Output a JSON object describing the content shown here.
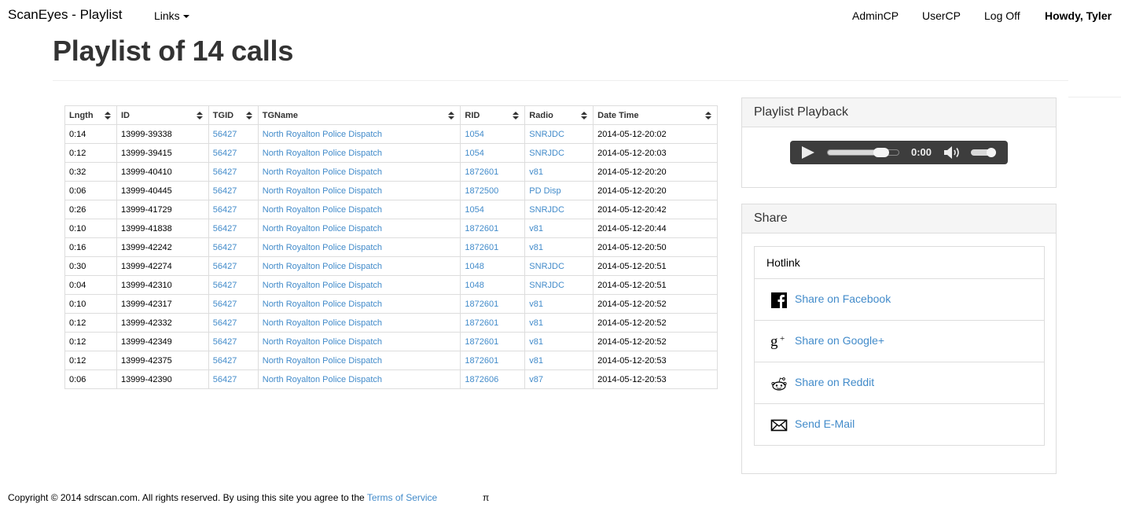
{
  "navbar": {
    "brand": "ScanEyes - Playlist",
    "links_label": "Links",
    "right_items": [
      {
        "label": "AdminCP"
      },
      {
        "label": "UserCP"
      },
      {
        "label": "Log Off"
      }
    ],
    "greeting": "Howdy, Tyler"
  },
  "page": {
    "title": "Playlist of 14 calls"
  },
  "table": {
    "headers": [
      "Lngth",
      "ID",
      "TGID",
      "TGName",
      "RID",
      "Radio",
      "Date Time"
    ],
    "rows": [
      {
        "length": "0:14",
        "id": "13999-39338",
        "tgid": "56427",
        "tgname": "North Royalton Police Dispatch",
        "rid": "1054",
        "radio": "SNRJDC",
        "datetime": "2014-05-12-20:02"
      },
      {
        "length": "0:12",
        "id": "13999-39415",
        "tgid": "56427",
        "tgname": "North Royalton Police Dispatch",
        "rid": "1054",
        "radio": "SNRJDC",
        "datetime": "2014-05-12-20:03"
      },
      {
        "length": "0:32",
        "id": "13999-40410",
        "tgid": "56427",
        "tgname": "North Royalton Police Dispatch",
        "rid": "1872601",
        "radio": "v81",
        "datetime": "2014-05-12-20:20"
      },
      {
        "length": "0:06",
        "id": "13999-40445",
        "tgid": "56427",
        "tgname": "North Royalton Police Dispatch",
        "rid": "1872500",
        "radio": "PD Disp",
        "datetime": "2014-05-12-20:20"
      },
      {
        "length": "0:26",
        "id": "13999-41729",
        "tgid": "56427",
        "tgname": "North Royalton Police Dispatch",
        "rid": "1054",
        "radio": "SNRJDC",
        "datetime": "2014-05-12-20:42"
      },
      {
        "length": "0:10",
        "id": "13999-41838",
        "tgid": "56427",
        "tgname": "North Royalton Police Dispatch",
        "rid": "1872601",
        "radio": "v81",
        "datetime": "2014-05-12-20:44"
      },
      {
        "length": "0:16",
        "id": "13999-42242",
        "tgid": "56427",
        "tgname": "North Royalton Police Dispatch",
        "rid": "1872601",
        "radio": "v81",
        "datetime": "2014-05-12-20:50"
      },
      {
        "length": "0:30",
        "id": "13999-42274",
        "tgid": "56427",
        "tgname": "North Royalton Police Dispatch",
        "rid": "1048",
        "radio": "SNRJDC",
        "datetime": "2014-05-12-20:51"
      },
      {
        "length": "0:04",
        "id": "13999-42310",
        "tgid": "56427",
        "tgname": "North Royalton Police Dispatch",
        "rid": "1048",
        "radio": "SNRJDC",
        "datetime": "2014-05-12-20:51"
      },
      {
        "length": "0:10",
        "id": "13999-42317",
        "tgid": "56427",
        "tgname": "North Royalton Police Dispatch",
        "rid": "1872601",
        "radio": "v81",
        "datetime": "2014-05-12-20:52"
      },
      {
        "length": "0:12",
        "id": "13999-42332",
        "tgid": "56427",
        "tgname": "North Royalton Police Dispatch",
        "rid": "1872601",
        "radio": "v81",
        "datetime": "2014-05-12-20:52"
      },
      {
        "length": "0:12",
        "id": "13999-42349",
        "tgid": "56427",
        "tgname": "North Royalton Police Dispatch",
        "rid": "1872601",
        "radio": "v81",
        "datetime": "2014-05-12-20:52"
      },
      {
        "length": "0:12",
        "id": "13999-42375",
        "tgid": "56427",
        "tgname": "North Royalton Police Dispatch",
        "rid": "1872601",
        "radio": "v81",
        "datetime": "2014-05-12-20:53"
      },
      {
        "length": "0:06",
        "id": "13999-42390",
        "tgid": "56427",
        "tgname": "North Royalton Police Dispatch",
        "rid": "1872606",
        "radio": "v87",
        "datetime": "2014-05-12-20:53"
      }
    ]
  },
  "playback": {
    "title": "Playlist Playback",
    "time": "0:00",
    "seek_buffered_fraction": 0.78,
    "volume_fraction": 0.8,
    "icons": {
      "play": "play-icon",
      "volume": "volume-icon"
    }
  },
  "share": {
    "title": "Share",
    "hotlink_label": "Hotlink",
    "items": [
      {
        "label": "Share on Facebook",
        "icon": "facebook-icon"
      },
      {
        "label": "Share on Google+",
        "icon": "google-plus-icon"
      },
      {
        "label": "Share on Reddit",
        "icon": "reddit-icon"
      },
      {
        "label": "Send E-Mail",
        "icon": "envelope-icon"
      }
    ]
  },
  "footer": {
    "text": "Copyright © 2014 sdrscan.com. All rights reserved. By using this site you agree to the ",
    "tos_label": "Terms of Service",
    "pi": "π"
  },
  "colors": {
    "link": "#428bca",
    "panel_heading_bg": "#f5f5f5",
    "border": "#dddddd",
    "player_bg": "#3d3d3d"
  }
}
